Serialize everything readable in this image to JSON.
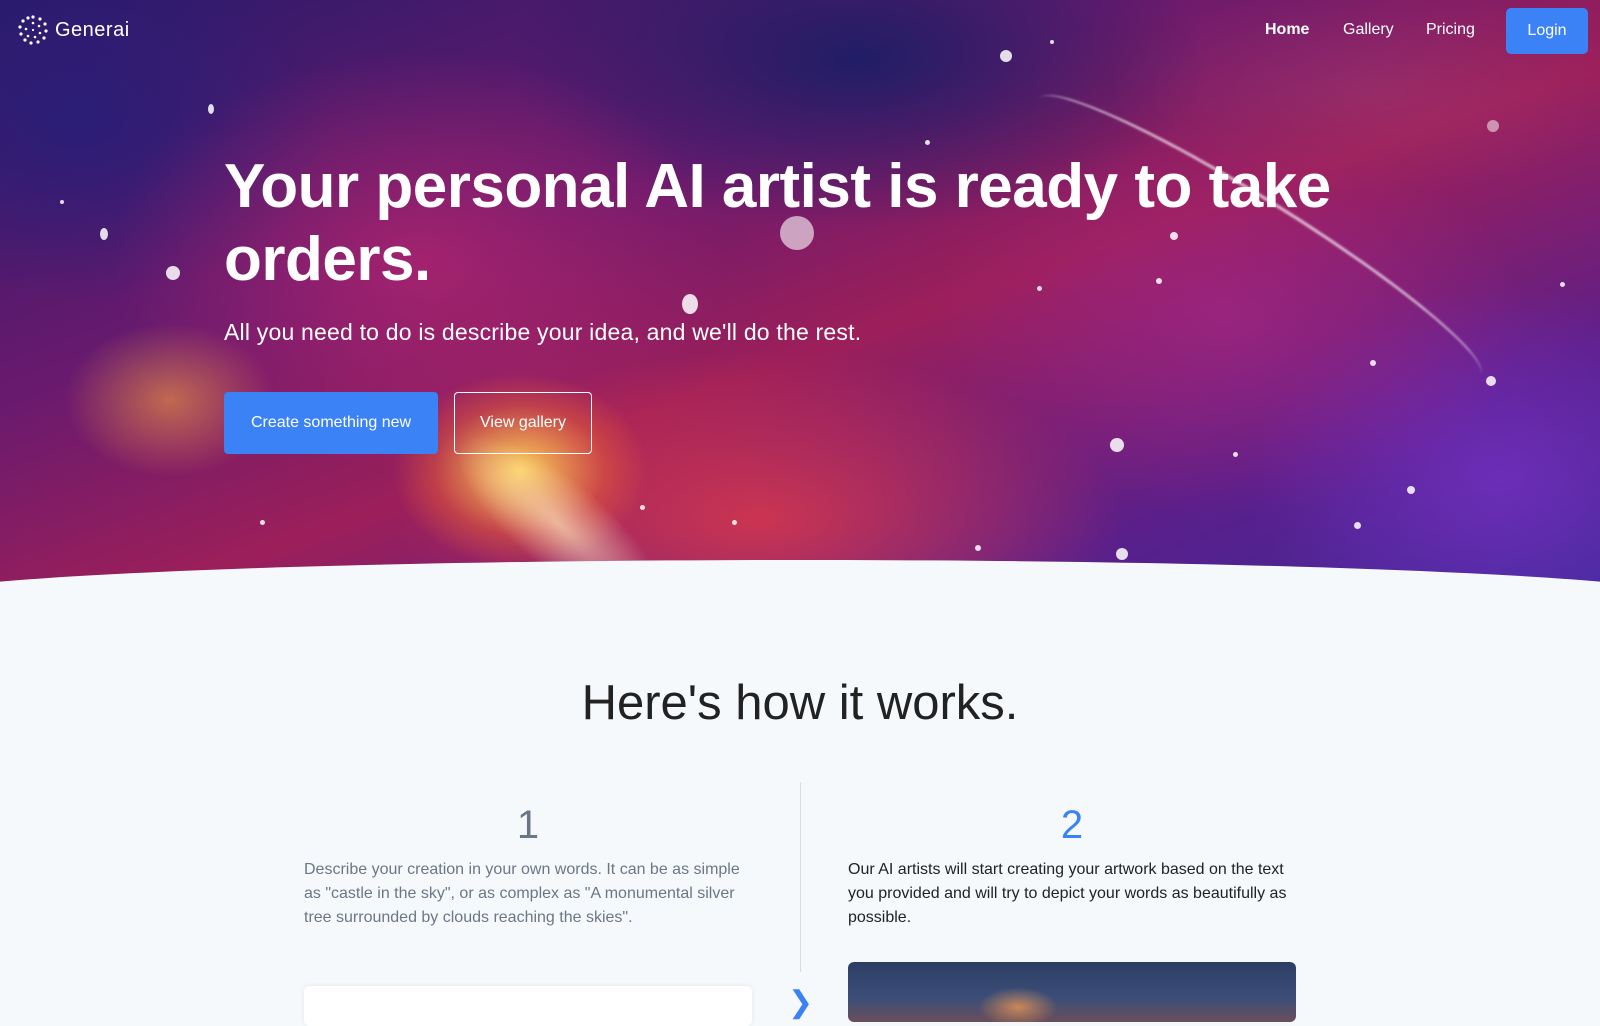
{
  "nav": {
    "brand": "Generai",
    "links": [
      {
        "label": "Home",
        "active": true
      },
      {
        "label": "Gallery",
        "active": false
      },
      {
        "label": "Pricing",
        "active": false
      }
    ],
    "login_label": "Login"
  },
  "hero": {
    "title": "Your personal AI artist is ready to take orders.",
    "subtitle": "All you need to do is describe your idea, and we'll do the rest.",
    "primary_button": "Create something new",
    "secondary_button": "View gallery"
  },
  "how_it_works": {
    "title": "Here's how it works.",
    "steps": [
      {
        "number": "1",
        "text": "Describe your creation in your own words. It can be as simple as \"castle in the sky\", or as complex as \"A monumental silver tree surrounded by clouds reaching the skies\"."
      },
      {
        "number": "2",
        "text": "Our AI artists will start creating your artwork based on the text you provided and will try to depict your words as beautifully as possible."
      }
    ]
  },
  "colors": {
    "accent": "#3b82f6",
    "page_bg": "#f6f9fc",
    "step_1_muted": "#6b7786"
  }
}
